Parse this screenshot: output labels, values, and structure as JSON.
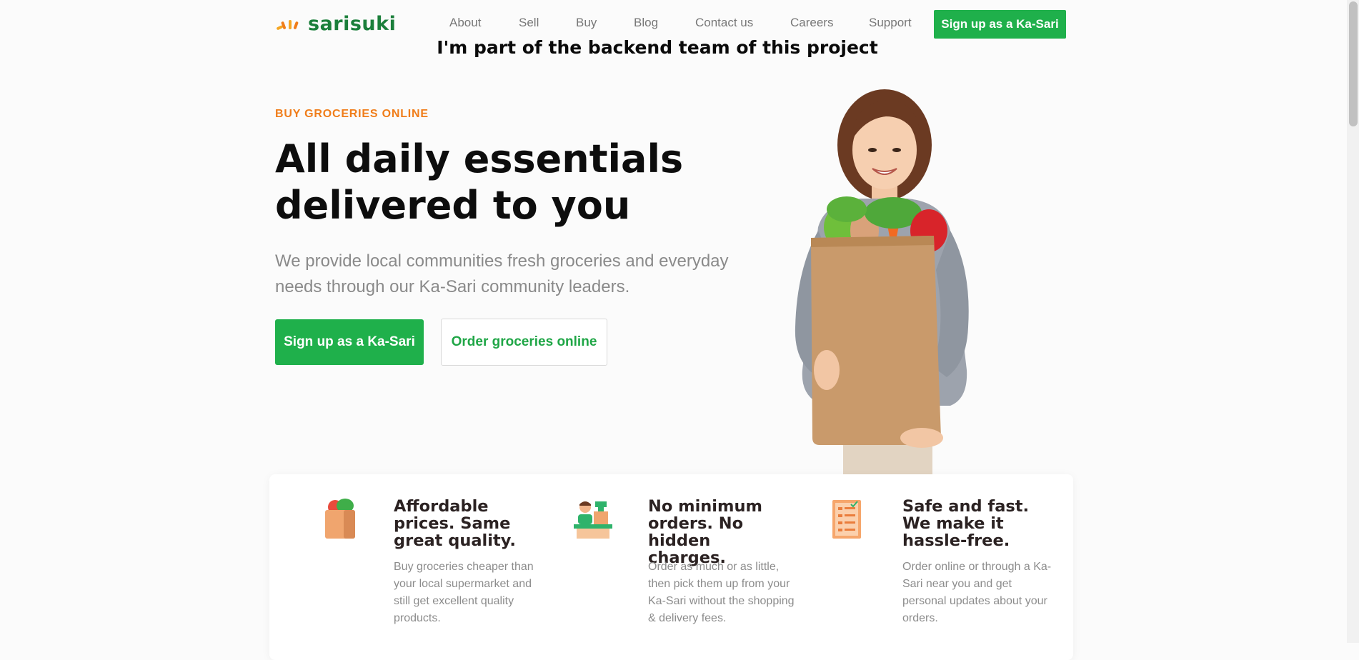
{
  "header": {
    "logo_text": "sarisuki",
    "nav": [
      "About",
      "Sell",
      "Buy",
      "Blog",
      "Contact us",
      "Careers",
      "Support"
    ],
    "cta": "Sign up as a Ka-Sari"
  },
  "caption": "I'm part of the backend team of this project",
  "hero": {
    "eyebrow": "BUY GROCERIES ONLINE",
    "title": "All daily essentials delivered to you",
    "subtitle": "We provide local communities fresh groceries and everyday needs through our Ka-Sari community leaders.",
    "primary_button": "Sign up as a Ka-Sari",
    "secondary_button": "Order groceries online"
  },
  "features": [
    {
      "icon": "grocery-bag-icon",
      "title": "Affordable prices. Same great quality.",
      "text": "Buy groceries cheaper than your local supermarket and still get excellent quality products."
    },
    {
      "icon": "cashier-icon",
      "title": "No minimum orders. No hidden charges.",
      "text": "Order as much or as little, then pick them up from your Ka-Sari without the shopping & delivery fees."
    },
    {
      "icon": "checklist-icon",
      "title": "Safe and fast. We make it hassle-free.",
      "text": "Order online or through a Ka-Sari near you and get personal updates about your orders."
    }
  ],
  "colors": {
    "brand_green": "#1fb04b",
    "logo_green": "#1b7f3b",
    "accent_orange": "#f07d1a"
  }
}
